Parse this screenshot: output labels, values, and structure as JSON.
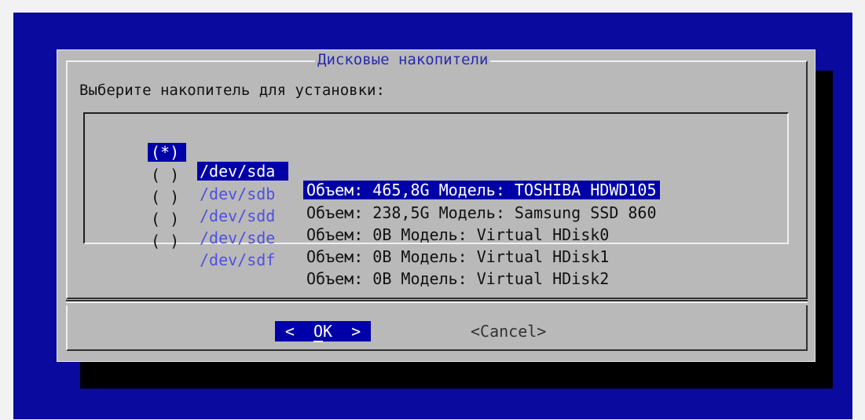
{
  "dialog": {
    "title": "Дисковые накопители",
    "prompt": "Выберите накопитель для установки:",
    "drives": [
      {
        "mark": "(*)",
        "device": "/dev/sda",
        "info": "Объем: 465,8G Модель: TOSHIBA HDWD105",
        "selected": true
      },
      {
        "mark": "( )",
        "device": "/dev/sdb",
        "info": "Объем: 238,5G Модель: Samsung SSD 860",
        "selected": false
      },
      {
        "mark": "( )",
        "device": "/dev/sdd",
        "info": "Объем: 0B Модель: Virtual HDisk0",
        "selected": false
      },
      {
        "mark": "( )",
        "device": "/dev/sde",
        "info": "Объем: 0B Модель: Virtual HDisk1",
        "selected": false
      },
      {
        "mark": "( )",
        "device": "/dev/sdf",
        "info": "Объем: 0B Модель: Virtual HDisk2",
        "selected": false
      }
    ],
    "buttons": {
      "ok_left": "<",
      "ok_hotkey": "O",
      "ok_rest": "K",
      "ok_right": ">",
      "cancel": "<Cancel>"
    }
  },
  "colors": {
    "background": "#0a0a9f",
    "dialog": "#b9b9b9",
    "selection": "#0000a8",
    "device_unselected": "#5050e0",
    "title": "#2a2ab0"
  }
}
